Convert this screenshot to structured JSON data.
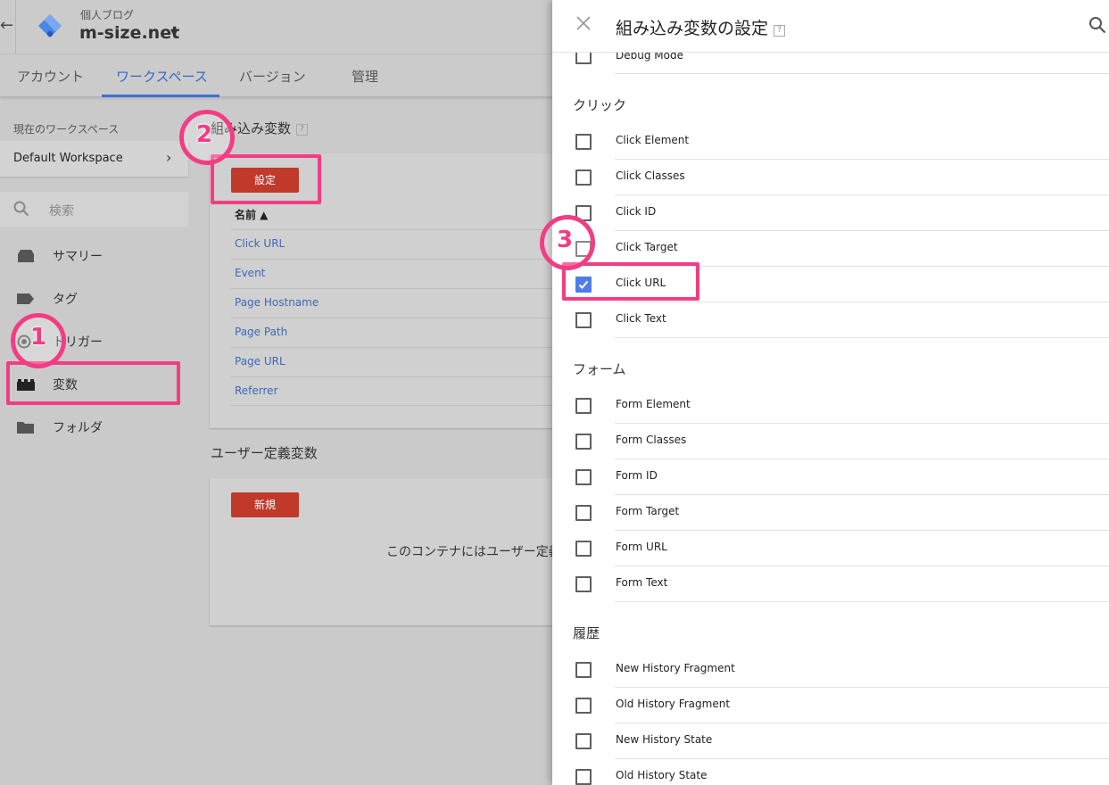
{
  "header": {
    "back_glyph": "←",
    "account_name": "個人ブログ",
    "container_name": "m-size.net",
    "caret": "▼"
  },
  "tabs": [
    {
      "label": "アカウント",
      "active": false
    },
    {
      "label": "ワークスペース",
      "active": true
    },
    {
      "label": "バージョン",
      "active": false
    },
    {
      "label": "管理",
      "active": false
    }
  ],
  "workspace": {
    "label": "現在のワークスペース",
    "name": "Default Workspace",
    "chevron": "›"
  },
  "search": {
    "placeholder": "検索"
  },
  "sidebar": {
    "items": [
      {
        "label": "サマリー",
        "icon": "summary-icon"
      },
      {
        "label": "タグ",
        "icon": "tag-icon"
      },
      {
        "label": "トリガー",
        "icon": "trigger-icon"
      },
      {
        "label": "変数",
        "icon": "variables-icon",
        "active": true
      },
      {
        "label": "フォルダ",
        "icon": "folder-icon"
      }
    ]
  },
  "builtin": {
    "title": "組み込み変数",
    "help": "?",
    "configure_button": "設定",
    "column_header": "名前 ▲",
    "rows": [
      "Click URL",
      "Event",
      "Page Hostname",
      "Page Path",
      "Page URL",
      "Referrer"
    ]
  },
  "user_defined": {
    "title": "ユーザー定義変数",
    "new_button": "新規",
    "empty_message": "このコンテナにはユーザー定義"
  },
  "annotations": {
    "step1": "1",
    "step2": "2",
    "step3": "3",
    "color": "#f23d84"
  },
  "panel": {
    "title": "組み込み変数の設定",
    "help": "?",
    "partial_item": "Debug Mode",
    "groups": [
      {
        "title": "クリック",
        "items": [
          {
            "label": "Click Element",
            "checked": false
          },
          {
            "label": "Click Classes",
            "checked": false
          },
          {
            "label": "Click ID",
            "checked": false
          },
          {
            "label": "Click Target",
            "checked": false
          },
          {
            "label": "Click URL",
            "checked": true
          },
          {
            "label": "Click Text",
            "checked": false
          }
        ]
      },
      {
        "title": "フォーム",
        "items": [
          {
            "label": "Form Element",
            "checked": false
          },
          {
            "label": "Form Classes",
            "checked": false
          },
          {
            "label": "Form ID",
            "checked": false
          },
          {
            "label": "Form Target",
            "checked": false
          },
          {
            "label": "Form URL",
            "checked": false
          },
          {
            "label": "Form Text",
            "checked": false
          }
        ]
      },
      {
        "title": "履歴",
        "items": [
          {
            "label": "New History Fragment",
            "checked": false
          },
          {
            "label": "Old History Fragment",
            "checked": false
          },
          {
            "label": "New History State",
            "checked": false
          },
          {
            "label": "Old History State",
            "checked": false
          }
        ]
      }
    ]
  },
  "colors": {
    "accent_blue": "#3369c8",
    "button_red": "#c0392b",
    "checkbox_blue": "#4f7de8",
    "link_blue": "#3d68b8"
  }
}
